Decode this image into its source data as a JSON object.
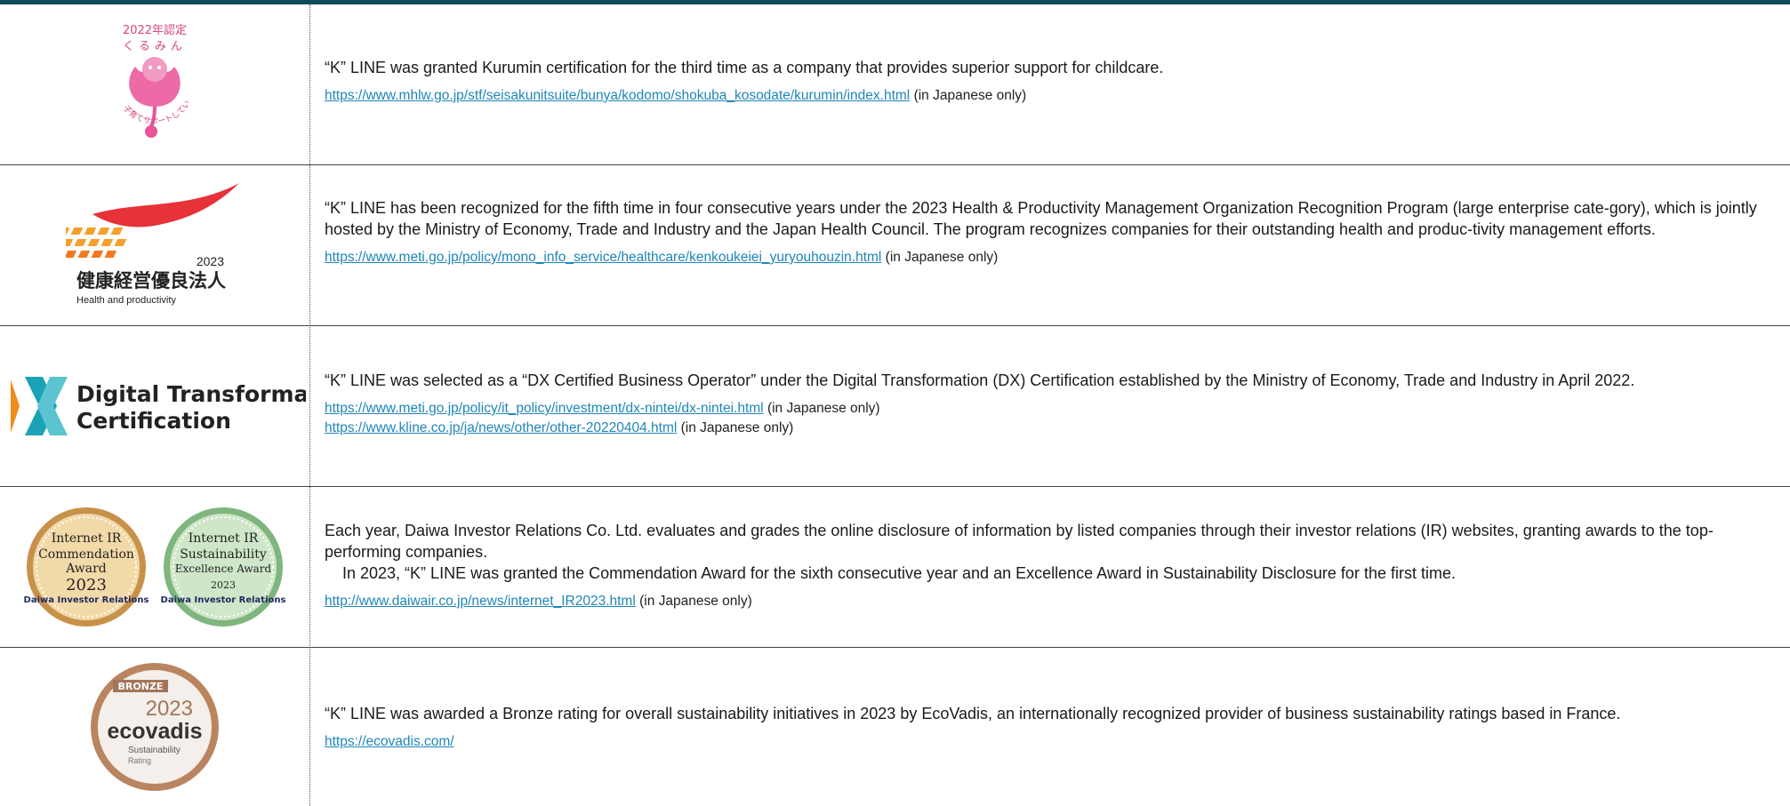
{
  "rows": [
    {
      "logo": {
        "icon": "kurumin-logo",
        "year_text": "2022年認定",
        "name_text": "くるみん",
        "slogan_text": "子育てサポートしています"
      },
      "text": "“K” LINE was granted Kurumin certification for the third time as a company that provides superior support for childcare.",
      "links": [
        {
          "url": "https://www.mhlw.go.jp/stf/seisakunitsuite/bunya/kodomo/shokuba_kosodate/kurumin/index.html",
          "note": "(in Japanese only)"
        }
      ]
    },
    {
      "logo": {
        "icon": "health-productivity-logo",
        "year_text": "2023",
        "jp_text": "健康経営優良法人",
        "en_text": "Health and productivity"
      },
      "text": "“K” LINE has been recognized for the fifth time in four consecutive years under the 2023 Health & Productivity Management Organization Recognition Program (large enterprise cate-gory), which is jointly hosted by the Ministry of Economy, Trade and Industry and the Japan Health Council. The program recognizes companies for their outstanding health and produc-tivity management efforts.",
      "links": [
        {
          "url": "https://www.meti.go.jp/policy/mono_info_service/healthcare/kenkoukeiei_yuryouhouzin.html",
          "note": "(in Japanese only)"
        }
      ]
    },
    {
      "logo": {
        "icon": "dx-certification-logo",
        "line1": "Digital Transformation",
        "line2": "Certification"
      },
      "text": "“K” LINE was selected as a “DX Certified Business Operator” under the Digital Transformation (DX) Certification established by the Ministry of Economy, Trade and Industry in April 2022.",
      "links": [
        {
          "url": "https://www.meti.go.jp/policy/it_policy/investment/dx-nintei/dx-nintei.html",
          "note": "(in Japanese only)"
        },
        {
          "url": "https://www.kline.co.jp/ja/news/other/other-20220404.html",
          "note": "(in Japanese only)"
        }
      ]
    },
    {
      "logo": {
        "badge1": {
          "l1": "Internet IR",
          "l2": "Commendation",
          "l3": "Award",
          "year": "2023",
          "org": "Daiwa Investor Relations"
        },
        "badge2": {
          "l1": "Internet IR",
          "l2": "Sustainability",
          "l3": "Excellence Award",
          "year": "2023",
          "org": "Daiwa Investor Relations"
        }
      },
      "text": "Each year, Daiwa Investor Relations Co. Ltd. evaluates and grades the online disclosure of information by listed companies through their investor relations (IR) websites, granting awards to the top-performing companies.",
      "text2": "In 2023, “K” LINE was granted the Commendation Award for the sixth consecutive year and an Excellence Award in Sustainability Disclosure for the first time.",
      "links": [
        {
          "url": "http://www.daiwair.co.jp/news/internet_IR2023.html",
          "note": "(in Japanese only)"
        }
      ]
    },
    {
      "logo": {
        "icon": "ecovadis-medal",
        "rank": "BRONZE",
        "year": "2023",
        "brand": "ecovadis",
        "sub1": "Sustainability",
        "sub2": "Rating"
      },
      "text": "“K” LINE was awarded a Bronze rating for overall sustainability initiatives in 2023 by EcoVadis, an internationally recognized provider of business sustainability ratings based in France.",
      "links": [
        {
          "url": "https://ecovadis.com/",
          "note": ""
        }
      ]
    }
  ],
  "colors": {
    "topbar": "#0f4a5a",
    "link": "#1f86b8",
    "kurumin_pink": "#e8559a",
    "dx_teal": "#1aa3b5",
    "dx_orange": "#f08c1e"
  }
}
